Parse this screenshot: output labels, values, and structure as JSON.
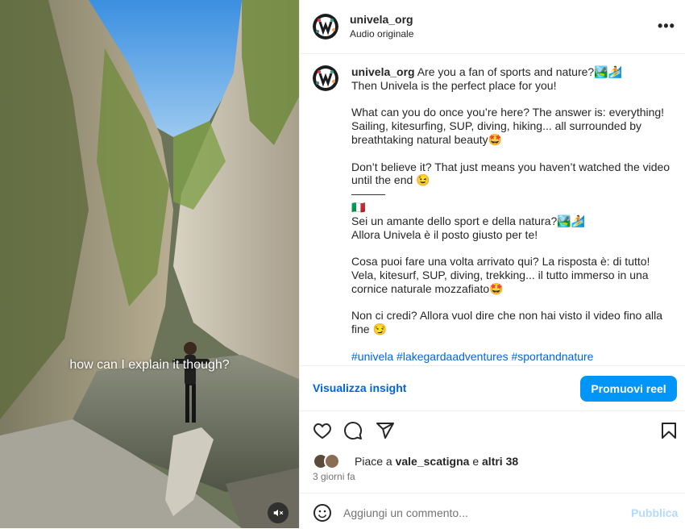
{
  "media": {
    "overlay_text": "how can I explain it though?",
    "mute_icon": "speaker-muted-icon"
  },
  "header": {
    "username": "univela_org",
    "audio": "Audio originale",
    "more_icon": "more-options-icon",
    "more_glyph": "•••"
  },
  "caption": {
    "username": "univela_org",
    "lines": [
      "Are you a fan of sports and nature?🏞️🏄",
      "Then Univela is the perfect place for you!",
      "",
      "What can you do once you’re here? The answer is: everything!",
      "Sailing, kitesurfing, SUP, diving, hiking... all surrounded by",
      "breathtaking natural beauty🤩",
      "",
      "Don’t believe it? That just means you haven’t watched the video",
      "until the end 😉",
      "———",
      "🇮🇹",
      "Sei un amante dello sport e della natura?🏞️🏄",
      "Allora Univela è il posto giusto per te!",
      "",
      "Cosa puoi fare una volta arrivato qui? La risposta è: di tutto!",
      "Vela, kitesurf, SUP, diving, trekking... il tutto immerso in una",
      "cornice naturale mozzafiato🤩",
      "",
      "Non ci credi? Allora vuol dire che non hai visto il video fino alla",
      "fine 😏"
    ],
    "hashtags": [
      "#univela",
      "#lakegardaadventures",
      "#sportandnature"
    ]
  },
  "insights": {
    "view_insights": "Visualizza insight",
    "promote": "Promuovi reel"
  },
  "actions": {
    "like_icon": "heart-icon",
    "comment_icon": "comment-icon",
    "share_icon": "share-icon",
    "save_icon": "bookmark-icon"
  },
  "likes": {
    "prefix": "Piace a ",
    "user": "vale_scatigna",
    "middle": " e ",
    "others": "altri 38"
  },
  "time_ago": "3 giorni fa",
  "comment": {
    "placeholder": "Aggiungi un commento...",
    "publish": "Pubblica",
    "emoji_icon": "emoji-icon"
  },
  "colors": {
    "link_blue": "#0064e0",
    "button_blue": "#0095f6",
    "publish_disabled": "#b3dbff",
    "hashtag": "#00376b"
  }
}
